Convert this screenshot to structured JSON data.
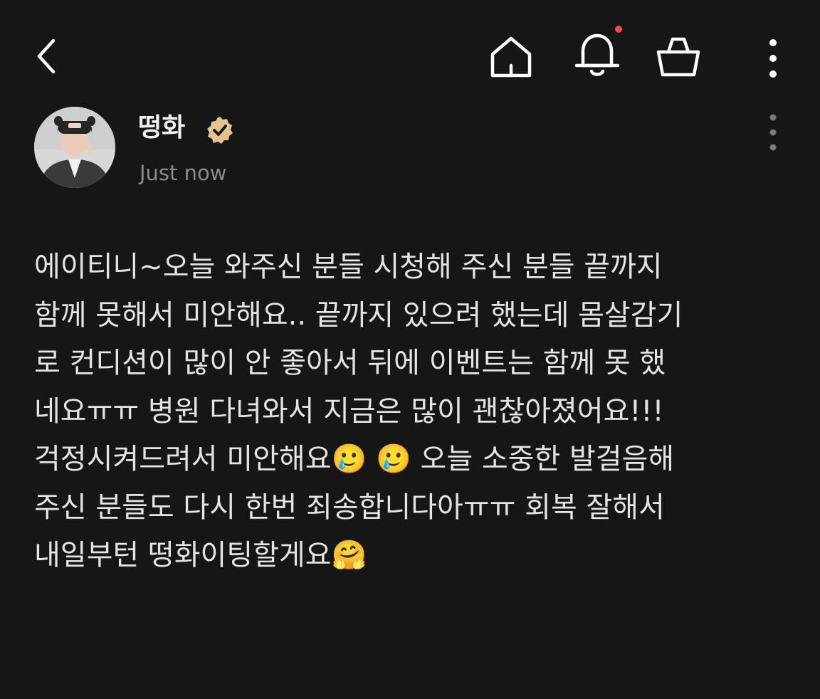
{
  "topbar": {
    "icons": {
      "back": "chevron-left-icon",
      "home": "home-icon",
      "notifications": "bell-icon",
      "shop": "shopping-bag-icon",
      "more": "more-vertical-icon"
    },
    "has_unread_notification": true,
    "notification_dot_color": "#f24a4a"
  },
  "post": {
    "author": {
      "name": "떵화",
      "verified": true,
      "verified_badge_color": "#e3c48c"
    },
    "time": "Just now",
    "body_lines": [
      "에이티니~오늘 와주신 분들 시청해 주신 분들 끝까지",
      "함께 못해서 미안해요.. 끝까지 있으려 했는데 몸살감기",
      "로 컨디션이 많이 안 좋아서 뒤에 이벤트는 함께 못 했",
      "네요ㅠㅠ 병원 다녀와서 지금은 많이 괜찮아졌어요!!!",
      "걱정시켜드려서 미안해요🥲 🥲  오늘 소중한 발걸음해",
      "주신 분들도 다시 한번 죄송합니다아ㅠㅠ 회복 잘해서",
      "내일부턴 떵화이팅할게요🤗"
    ]
  },
  "colors": {
    "background": "#161616",
    "text": "#e4e4e4",
    "muted": "#8a8a8a",
    "icon": "#ffffff"
  }
}
